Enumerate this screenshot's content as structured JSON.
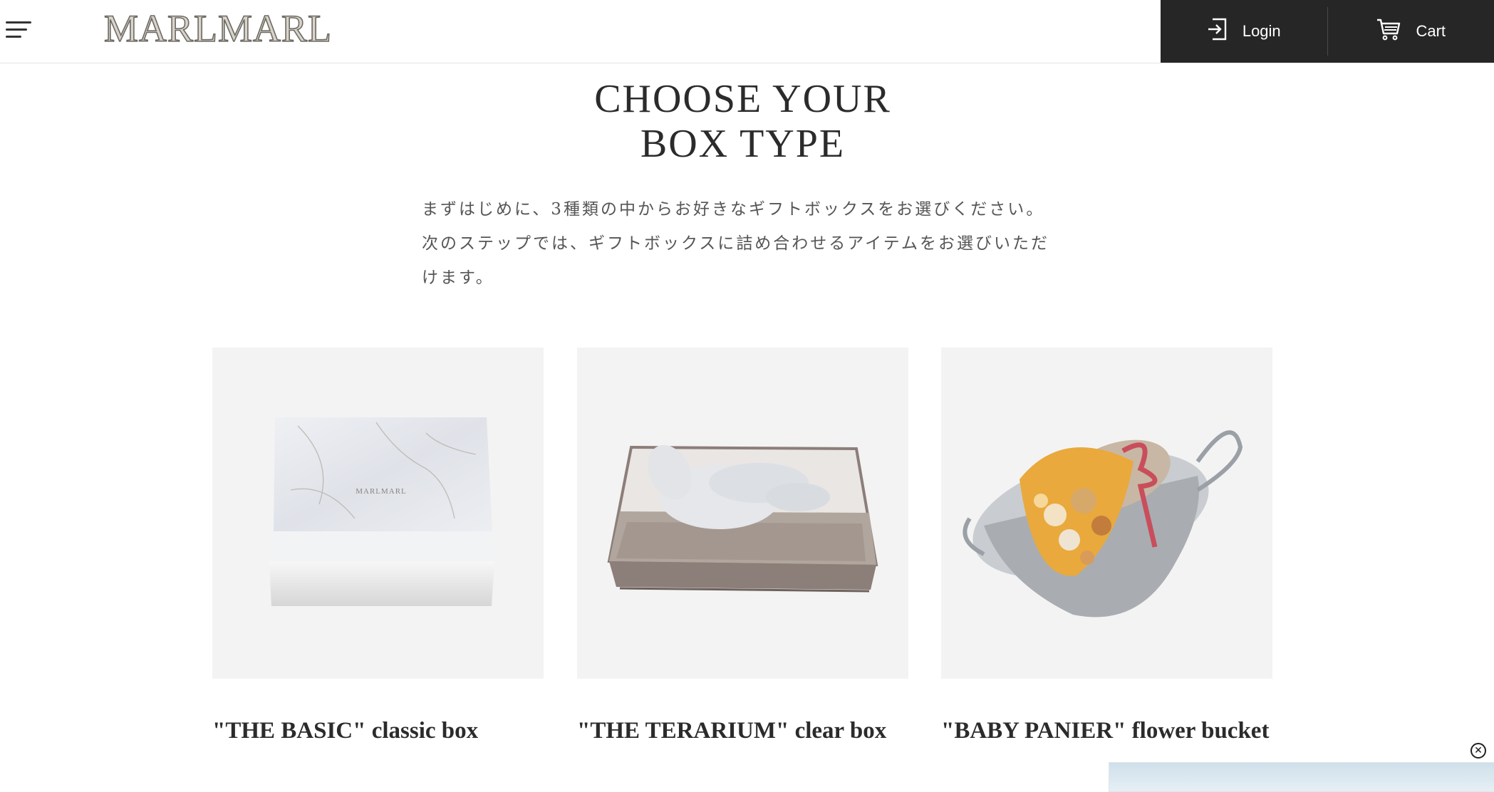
{
  "header": {
    "logo_text": "MARLMARL",
    "login_label": "Login",
    "cart_label": "Cart",
    "menu_icon": "hamburger-menu-icon",
    "login_icon": "login-icon",
    "cart_icon": "cart-icon"
  },
  "intro": {
    "title_line1": "CHOOSE YOUR",
    "title_line2": "BOX TYPE",
    "description": "まずはじめに、3種類の中からお好きなギフトボックスをお選びください。次のステップでは、ギフトボックスに詰め合わせるアイテムをお選びいただけます。"
  },
  "boxes": [
    {
      "title": "\"THE BASIC\" classic box",
      "image_label": "MARLMARL"
    },
    {
      "title": "\"THE TERARIUM\" clear box"
    },
    {
      "title": "\"BABY PANIER\" flower bucket"
    }
  ],
  "popup": {
    "close_icon": "close-icon"
  },
  "colors": {
    "header_dark": "#262626",
    "card_bg": "#f3f3f3",
    "text": "#2b2b2b"
  }
}
